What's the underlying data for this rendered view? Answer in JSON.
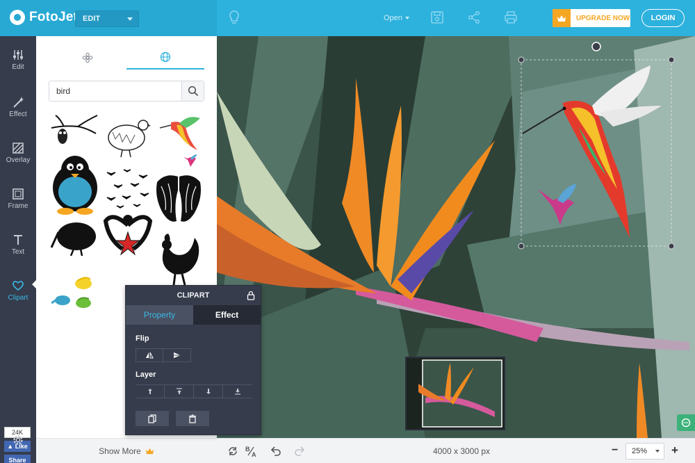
{
  "app": {
    "name": "FotoJet",
    "mode": "EDIT"
  },
  "topbar": {
    "open_label": "Open",
    "upgrade_label": "UPGRADE NOW",
    "login_label": "LOGIN"
  },
  "rail": {
    "items": [
      "Edit",
      "Effect",
      "Overlay",
      "Frame",
      "Text",
      "Clipart"
    ],
    "active": "Clipart"
  },
  "social": {
    "count": "24K",
    "like": "Like",
    "share": "Share"
  },
  "clipart_panel": {
    "search_value": "bird",
    "show_more": "Show More"
  },
  "popover": {
    "title": "CLIPART",
    "tabs": [
      "Property",
      "Effect"
    ],
    "flip_label": "Flip",
    "layer_label": "Layer"
  },
  "bottombar": {
    "dimensions": "4000 x 3000 px",
    "zoom": "25%"
  },
  "colors": {
    "accent": "#2db1dd",
    "upgrade": "#f5a623",
    "rail": "#363c4b"
  }
}
